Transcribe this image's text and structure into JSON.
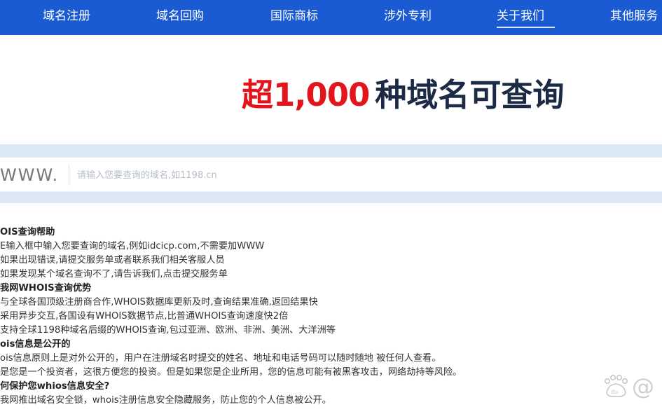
{
  "nav": {
    "items": [
      {
        "label": "域名注册"
      },
      {
        "label": "域名回购"
      },
      {
        "label": "国际商标"
      },
      {
        "label": "涉外专利"
      },
      {
        "label": "关于我们"
      },
      {
        "label": "其他服务"
      }
    ],
    "active_index": 4
  },
  "hero": {
    "prefix": "超",
    "number": "1,000",
    "suffix": "种域名可查询"
  },
  "search": {
    "www": "WWW.",
    "placeholder": "请输入您要查询的域名,如1198.cn"
  },
  "help": {
    "lines": [
      {
        "text": "OIS查询帮助",
        "heading": true
      },
      {
        "text": "E输入框中输入您要查询的域名,例如idcicp.com,不需要加WWW",
        "heading": false
      },
      {
        "text": "如果出现错误,请提交服务单或者联系我们相关客服人员",
        "heading": false
      },
      {
        "text": "如果发现某个域名查询不了,请告诉我们,点击提交服务单",
        "heading": false
      },
      {
        "text": "我网WHOIS查询优势",
        "heading": true
      },
      {
        "text": "与全球各国顶级注册商合作,WHOIS数据库更新及时,查询结果准确,返回结果快",
        "heading": false
      },
      {
        "text": "采用异步交互,各国设有WHOIS数据节点,比普通WHOIS查询速度快2倍",
        "heading": false
      },
      {
        "text": "支持全球1198种域名后缀的WHOIS查询,包过亚洲、欧洲、非洲、美洲、大洋洲等",
        "heading": false
      },
      {
        "text": "ois信息是公开的",
        "heading": true
      },
      {
        "text": "ois信息原则上是对外公开的，用户在注册域名时提交的姓名、地址和电话号码可以随时随地 被任何人查看。",
        "heading": false
      },
      {
        "text": "是您是一个投资者，这很方便您的投资。但是如果您是企业所用，您的信息可能有被黑客攻击，网络劫持等风险。",
        "heading": false
      },
      {
        "text": "何保护您whios信息安全?",
        "heading": true
      },
      {
        "text": "我网推出域名安全锁，whois注册信息安全隐藏服务，防止您的个人信息被公开。",
        "heading": false
      }
    ]
  },
  "watermark": {
    "text": "@"
  },
  "colors": {
    "nav_bg": "#1a5ad2",
    "hero_red": "#e3141b",
    "hero_dark": "#1c2a45",
    "search_band": "#dbe9f6"
  }
}
